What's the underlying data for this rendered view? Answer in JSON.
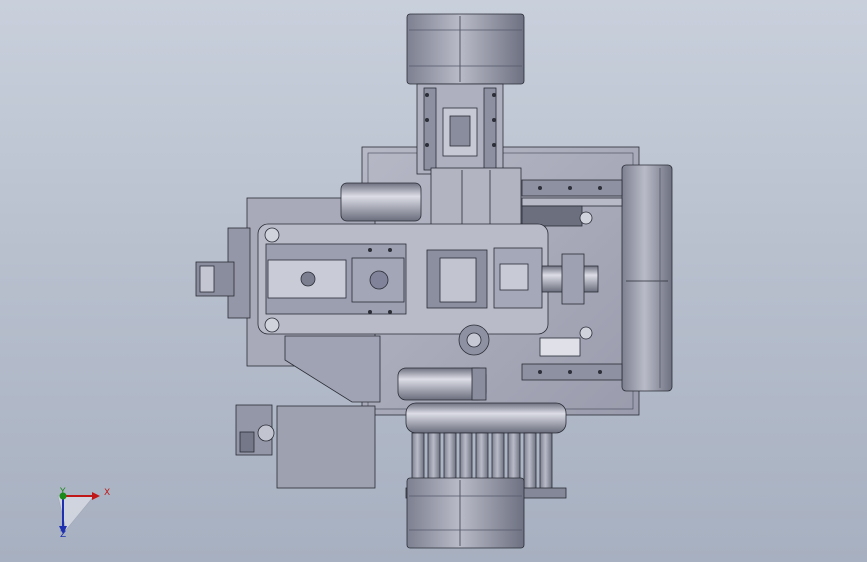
{
  "triad": {
    "x_label": "X",
    "y_label": "Y",
    "z_label": "Z",
    "x_color": "#c01818",
    "y_color": "#1a8a1a",
    "z_color": "#1e2fb0"
  },
  "colors": {
    "background_top": "#c9d0dc",
    "background_bottom": "#a7b0c0",
    "part_light": "#c4c6d2",
    "part_mid": "#9fa2b3",
    "part_dark": "#5d6070",
    "edge": "#2a2c36"
  }
}
